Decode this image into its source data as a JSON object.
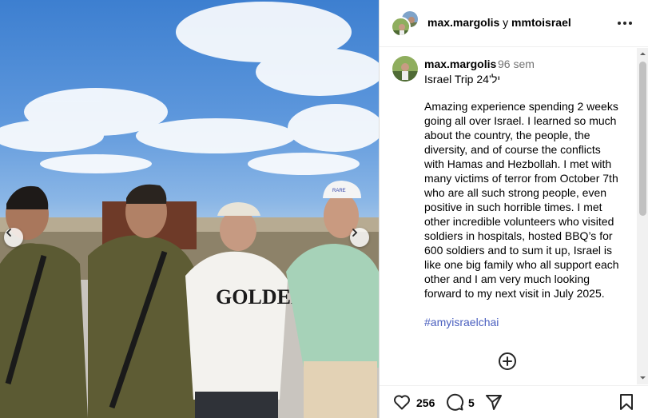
{
  "header": {
    "user1": "max.margolis",
    "conjunction": "y",
    "user2": "mmtoisrael"
  },
  "caption": {
    "username": "max.margolis",
    "time": "96 sem",
    "title": "Israel Trip 24’יל",
    "body": "Amazing experience spending 2 weeks\ngoing all over Israel. I learned so much\nabout the country, the people, the\ndiversity, and of course the conflicts\nwith Hamas and Hezbollah. I met with\nmany victims of terror from October 7th\nwho are all such strong people, even\npositive in such horrible times. I met\nother incredible volunteers who visited\nsoldiers in hospitals, hosted BBQ’s for\n600 soldiers and to sum it up, Israel is\nlike one big family who all support each\nother and I am very much looking\nforward to my next visit in July 2025.",
    "hashtag": "#amyisraelchai"
  },
  "photo": {
    "shirt_text": "GOLDEN",
    "cap_text": "RARE"
  },
  "actions": {
    "likes": "256",
    "comments": "5"
  },
  "icons": {
    "prev": "chevron-left-icon",
    "next": "chevron-right-icon",
    "more": "more-options-icon",
    "add": "add-circle-icon",
    "like": "heart-icon",
    "comment": "comment-icon",
    "share": "send-icon",
    "save": "bookmark-icon"
  },
  "colors": {
    "hashtag": "#4a5fbf",
    "muted": "#737373"
  }
}
